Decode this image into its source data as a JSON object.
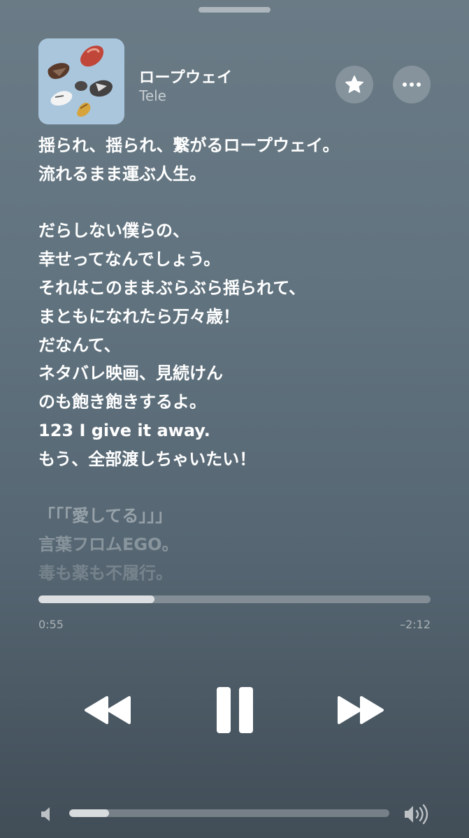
{
  "now_playing": {
    "title": "ロープウェイ",
    "artist": "Tele"
  },
  "actions": {
    "favorite_icon": "star-icon",
    "more_icon": "ellipsis-icon"
  },
  "lyrics": {
    "lines": [
      "揺られ、揺られ、繋がるロープウェイ。",
      "流れるまま運ぶ人生。",
      "",
      "だらしない僕らの、",
      "幸せってなんでしょう。",
      "それはこのままぶらぶら揺られて、",
      "まともになれたら万々歳！",
      "だなんて、",
      "ネタバレ映画、見続けん",
      "のも飽き飽きするよ。",
      "123 I give it away.",
      "もう、全部渡しちゃいたい！",
      "",
      "「「「愛してる」」」",
      "言葉フロムEGO。",
      "毒も薬も不履行。"
    ]
  },
  "playback": {
    "elapsed": "0:55",
    "remaining": "–2:12",
    "progress_fraction": 0.296
  },
  "controls": {
    "rewind_icon": "rewind-icon",
    "pause_icon": "pause-icon",
    "forward_icon": "fast-forward-icon"
  },
  "volume": {
    "level_fraction": 0.125,
    "low_icon": "speaker-low-icon",
    "high_icon": "speaker-high-icon"
  },
  "colors": {
    "background_top": "#6a7b86",
    "background_bottom": "#414d57",
    "text": "#ffffff",
    "artwork_bg": "#a9c6dd"
  }
}
